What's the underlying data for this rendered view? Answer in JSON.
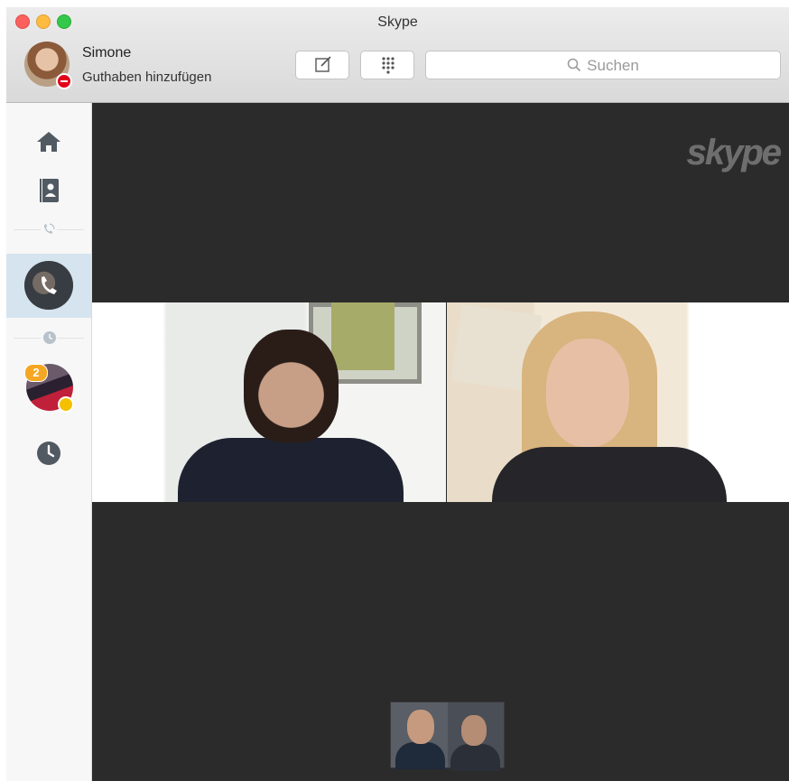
{
  "window": {
    "title": "Skype"
  },
  "profile": {
    "name": "Simone",
    "credit_link": "Guthaben hinzufügen",
    "status": "do-not-disturb"
  },
  "toolbar": {
    "compose_icon": "compose-icon",
    "dialpad_icon": "dialpad-icon",
    "search_placeholder": "Suchen"
  },
  "sidebar": {
    "items": [
      {
        "icon": "home-icon"
      },
      {
        "icon": "contacts-icon"
      },
      {
        "icon": "call-divider-icon"
      },
      {
        "icon": "active-call",
        "active": true
      },
      {
        "icon": "recent-divider-icon"
      },
      {
        "icon": "group-conversation",
        "badge": "2"
      },
      {
        "icon": "history-icon"
      }
    ]
  },
  "call": {
    "logo": "skype",
    "participants": 2,
    "self_view": true
  },
  "colors": {
    "video_bg": "#2b2b2b",
    "sidebar_bg": "#f7f7f7",
    "active_row": "#d6e4ef",
    "badge": "#f5a623",
    "dnd": "#e2001a",
    "icon_gray": "#515a62"
  }
}
